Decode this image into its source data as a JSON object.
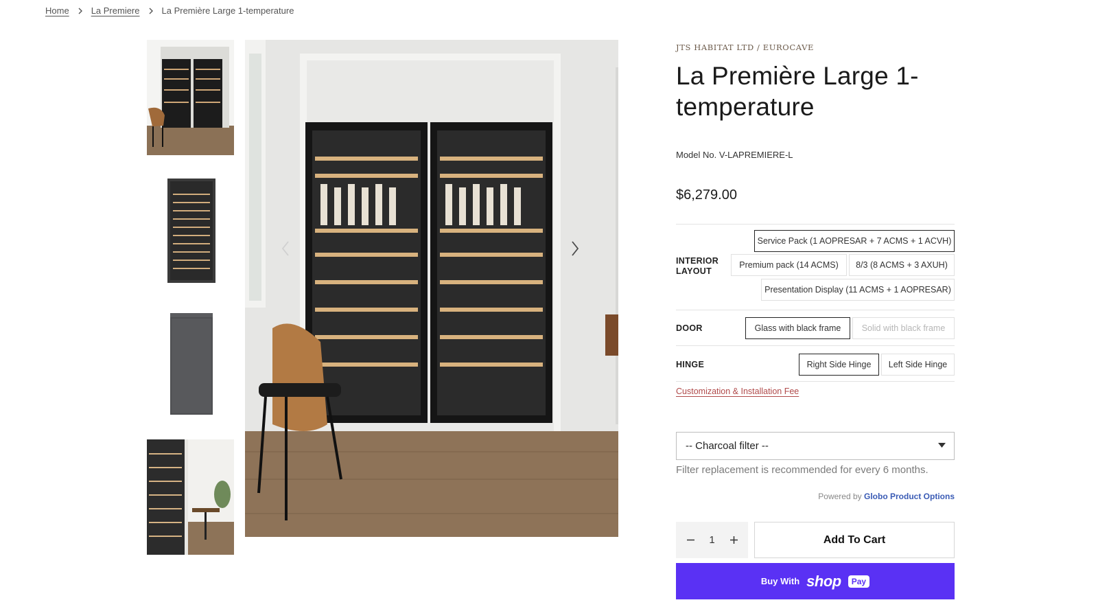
{
  "breadcrumb": {
    "home": "Home",
    "collection": "La Premiere",
    "current": "La Première Large 1-temperature"
  },
  "gallery": {
    "thumbnails": [
      "wine-cabinet-double-room",
      "wine-cabinet-single-glass",
      "wine-cabinet-solid-door",
      "wine-cabinet-detail-room"
    ],
    "main_image": "double-wine-cabinet-in-room"
  },
  "product": {
    "vendor": "JTS HABITAT LTD / EUROCAVE",
    "title": "La Première Large 1-temperature",
    "model": "Model No. V-LAPREMIERE-L",
    "price": "$6,279.00"
  },
  "options": {
    "interior_layout": {
      "label_line1": "INTERIOR",
      "label_line2": "LAYOUT",
      "choices": [
        "Service Pack (1 AOPRESAR + 7 ACMS + 1 ACVH)",
        "Premium pack (14 ACMS)",
        "8/3 (8 ACMS + 3 AXUH)",
        "Presentation Display (11 ACMS + 1 AOPRESAR)"
      ],
      "selected": "Service Pack (1 AOPRESAR + 7 ACMS + 1 ACVH)"
    },
    "door": {
      "label": "DOOR",
      "choices": [
        "Glass with black frame",
        "Solid with black frame"
      ],
      "selected": "Glass with black frame",
      "unavailable": "Solid with black frame"
    },
    "hinge": {
      "label": "HINGE",
      "choices": [
        "Right Side Hinge",
        "Left Side Hinge"
      ],
      "selected": "Right Side Hinge"
    }
  },
  "fee_link": "Customization & Installation Fee",
  "filter": {
    "selected": "-- Charcoal filter --",
    "help": "Filter replacement is recommended for every 6 months.",
    "powered_prefix": "Powered by",
    "powered_brand": "Globo Product Options"
  },
  "cart": {
    "quantity": "1",
    "add_label": "Add To Cart",
    "buy_with": "Buy With",
    "shop_word": "shop",
    "pay_word": "Pay"
  },
  "colors": {
    "accent_link": "#b04a4a",
    "shop_pay": "#5a31f4",
    "globo_link": "#3a5bb5"
  }
}
